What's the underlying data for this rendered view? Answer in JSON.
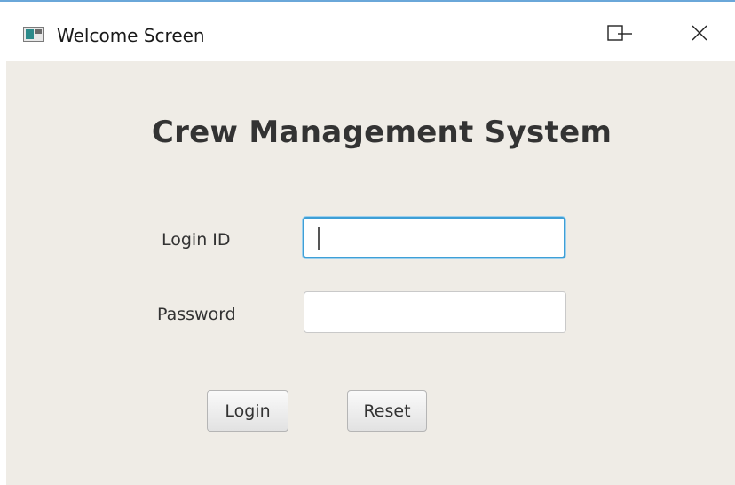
{
  "window": {
    "title": "Welcome Screen",
    "app_icon": "app-window-icon",
    "controls": {
      "minimize_icon": "minimize-icon",
      "maximize_icon": "maximize-icon",
      "close_icon": "close-icon"
    }
  },
  "form": {
    "heading": "Crew Management System",
    "login_id": {
      "label": "Login ID",
      "value": "",
      "focused": true
    },
    "password": {
      "label": "Password",
      "value": ""
    },
    "buttons": {
      "login": "Login",
      "reset": "Reset"
    }
  },
  "colors": {
    "client_background": "#efece6",
    "focus_ring": "#3e9fd6",
    "title_border": "#6aa7d9"
  }
}
